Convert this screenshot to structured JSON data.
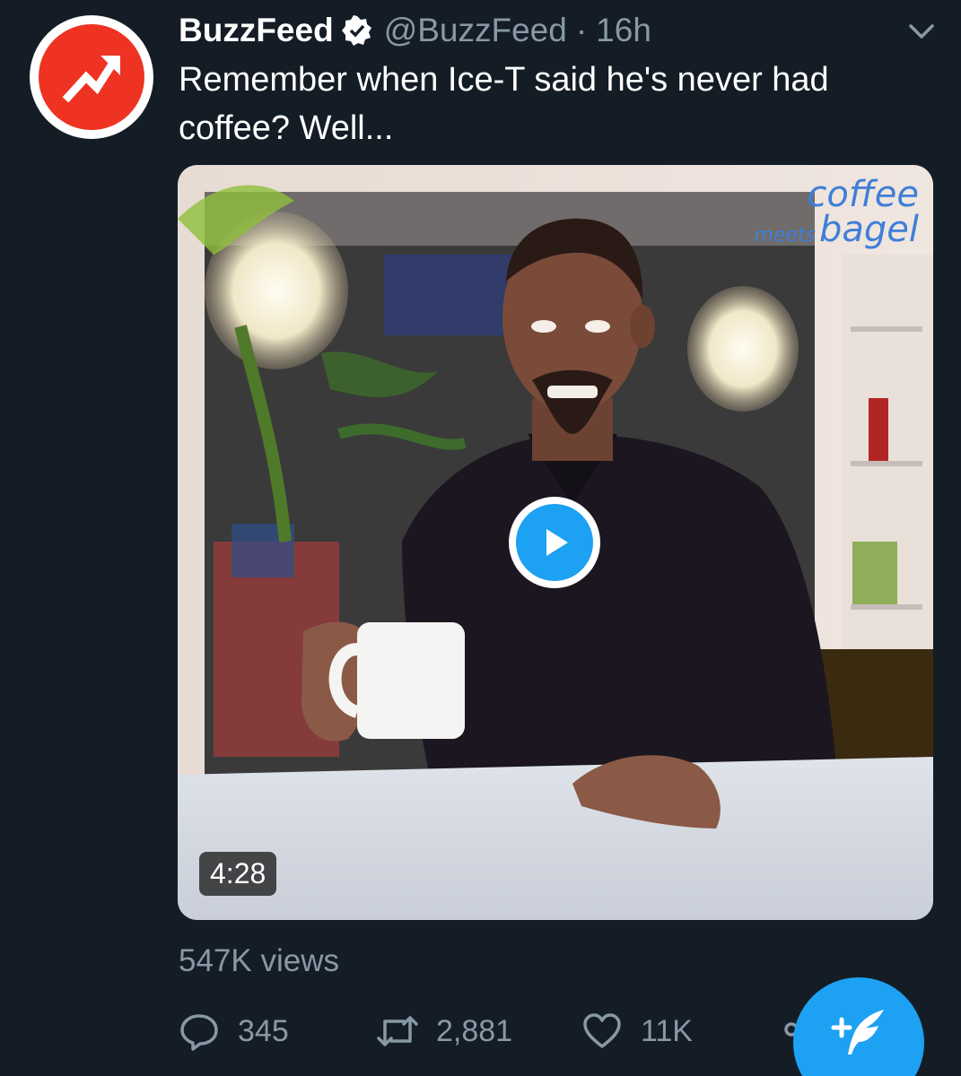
{
  "tweet": {
    "author": {
      "display_name": "BuzzFeed",
      "verified": true,
      "handle": "@BuzzFeed",
      "avatar_icon": "buzzfeed-trending-arrow-icon",
      "avatar_color": "#ee3322"
    },
    "separator": "·",
    "time": "16h",
    "text": "Remember when Ice-T said he's never had coffee? Well...",
    "media": {
      "type": "video",
      "watermark": {
        "coffee": "coffee",
        "meets": "meets",
        "bagel": "bagel"
      },
      "duration": "4:28",
      "play_icon": "play-icon"
    },
    "views": "547K views",
    "actions": {
      "reply": {
        "icon": "reply-icon",
        "count": "345"
      },
      "retweet": {
        "icon": "retweet-icon",
        "count": "2,881"
      },
      "like": {
        "icon": "heart-icon",
        "count": "11K"
      },
      "share": {
        "icon": "share-icon"
      }
    }
  },
  "compose": {
    "icon": "compose-tweet-icon"
  },
  "colors": {
    "background": "#141d26",
    "accent": "#1da1f2",
    "secondary_text": "#8899a6",
    "brand": "#ee3322"
  }
}
